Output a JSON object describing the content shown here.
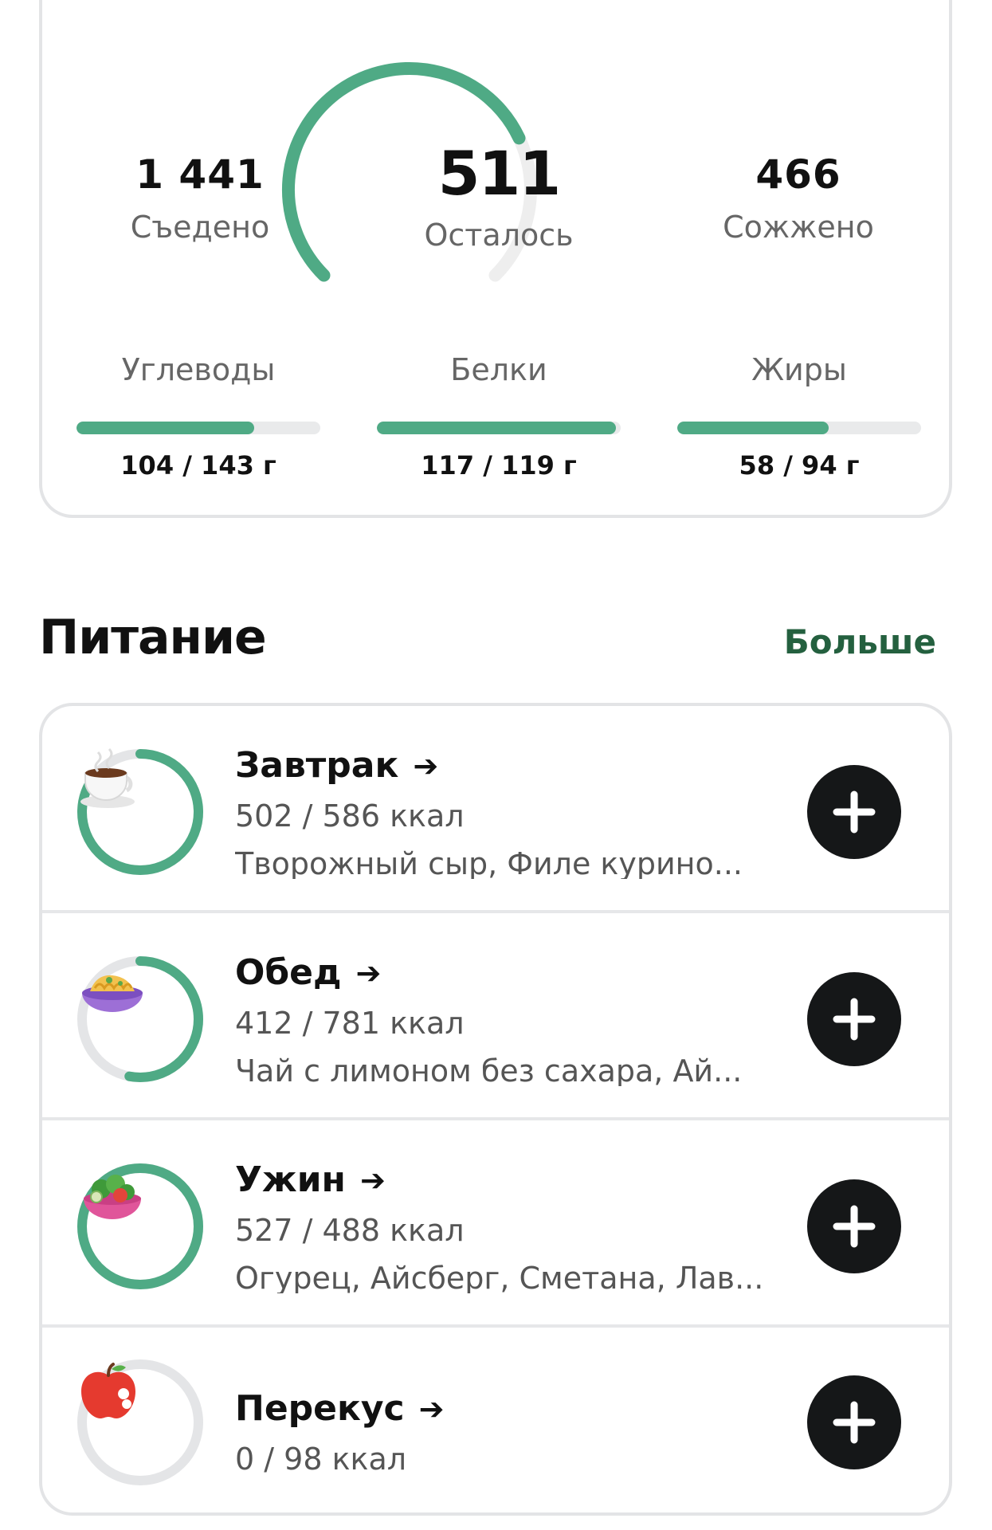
{
  "summary": {
    "eaten": {
      "value": "1 441",
      "label": "Съедено"
    },
    "remaining": {
      "value": "511",
      "label": "Осталось"
    },
    "burned": {
      "value": "466",
      "label": "Сожжено"
    },
    "gauge_progress_fraction": 0.74,
    "accent_color": "#4faa85",
    "track_color": "#eeeeee"
  },
  "macros": [
    {
      "label": "Углеводы",
      "value": "104 / 143 г",
      "progress": 0.73
    },
    {
      "label": "Белки",
      "value": "117 / 119 г",
      "progress": 0.98
    },
    {
      "label": "Жиры",
      "value": "58 / 94 г",
      "progress": 0.62
    }
  ],
  "nutrition": {
    "title": "Питание",
    "more_label": "Больше",
    "meals": [
      {
        "name": "Завтрак",
        "arrow": "➔",
        "kcal": "502 / 586 ккал",
        "items": "Творожный сыр, Филе курино...",
        "icon": "coffee-cup-icon",
        "emoji": "☕",
        "progress": 0.86
      },
      {
        "name": "Обед",
        "arrow": "➔",
        "kcal": "412 / 781 ккал",
        "items": "Чай с лимоном без сахара, Ай...",
        "icon": "pasta-bowl-icon",
        "emoji": "🍝",
        "progress": 0.53
      },
      {
        "name": "Ужин",
        "arrow": "➔",
        "kcal": "527 / 488 ккал",
        "items": "Огурец, Айсберг, Сметана, Лав...",
        "icon": "salad-icon",
        "emoji": "🥗",
        "progress": 1.0
      },
      {
        "name": "Перекус",
        "arrow": "➔",
        "kcal": "0 / 98 ккал",
        "items": "",
        "icon": "apple-icon",
        "emoji": "🍎",
        "progress": 0
      }
    ]
  }
}
